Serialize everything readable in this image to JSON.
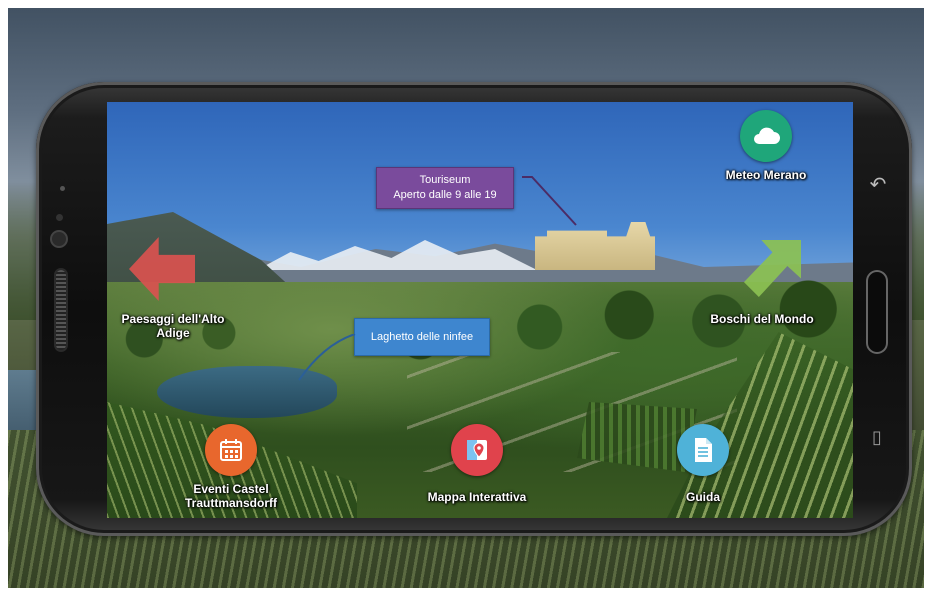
{
  "screen": {
    "nav_left": {
      "label": "Paesaggi dell'Alto Adige",
      "icon": "arrow-left-icon",
      "color": "#d9534f"
    },
    "nav_right": {
      "label": "Boschi del Mondo",
      "icon": "arrow-up-right-icon",
      "color": "#8cc152"
    },
    "weather": {
      "label": "Meteo Merano",
      "icon": "cloud-icon",
      "color": "#1fa67a"
    },
    "poi_touriseum": {
      "line1": "Touriseum",
      "line2": "Aperto dalle 9 alle 19",
      "color": "#7a4b9c"
    },
    "poi_lake": {
      "label": "Laghetto delle ninfee",
      "color": "#3e86cf"
    },
    "bottom_actions": [
      {
        "label": "Eventi Castel Trauttmansdorff",
        "icon": "calendar-icon",
        "color": "#e8672d"
      },
      {
        "label": "Mappa Interattiva",
        "icon": "map-pin-icon",
        "color": "#e0434c"
      },
      {
        "label": "Guida",
        "icon": "document-icon",
        "color": "#4fb2d8"
      }
    ]
  }
}
